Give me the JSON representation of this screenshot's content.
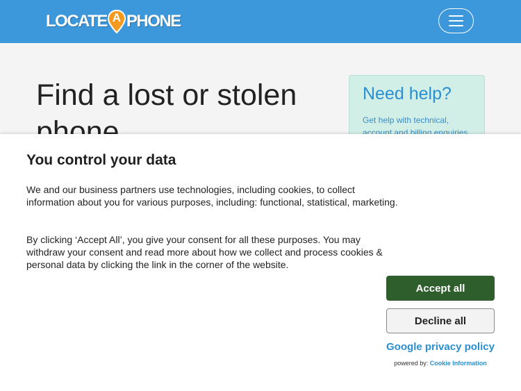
{
  "header": {
    "logo_left": "LOCATE",
    "logo_pin": "A",
    "logo_right": "PHONE",
    "menu_icon": "hamburger-icon",
    "brand_color": "#3d97db",
    "pin_color": "#f39a1e"
  },
  "main": {
    "title": "Find a lost or stolen phone"
  },
  "help": {
    "title": "Need help?",
    "text": "Get help with technical, account and billing enquiries."
  },
  "cookie": {
    "title": "You control your data",
    "paragraph1": "We and our business partners use technologies, including cookies, to collect information about you for various purposes, including: functional, statistical, marketing.",
    "paragraph2": "By clicking ‘Accept All’, you give your consent for all these purposes. You may withdraw your consent and read more about how we collect and process cookies & personal data by clicking the link in the corner of the website.",
    "accept_label": "Accept all",
    "decline_label": "Decline all",
    "privacy_link": "Google privacy policy",
    "powered_by": "powered by:",
    "powered_link": "Cookie Information",
    "accept_color": "#2d5e2c"
  }
}
